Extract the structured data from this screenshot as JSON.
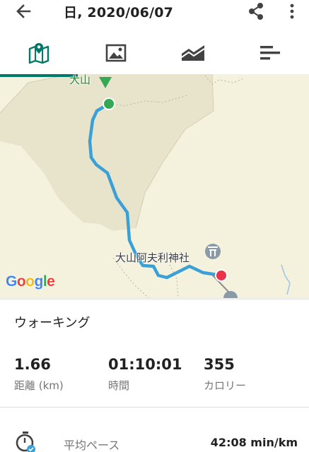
{
  "header": {
    "title": "日, 2020/06/07",
    "back_icon": "arrow-left-icon",
    "share_icon": "share-icon",
    "more_icon": "more-vertical-icon"
  },
  "tabs": [
    {
      "name": "map",
      "icon": "map-icon",
      "selected": true
    },
    {
      "name": "photos",
      "icon": "image-icon",
      "selected": false
    },
    {
      "name": "elevation",
      "icon": "area-chart-icon",
      "selected": false
    },
    {
      "name": "details",
      "icon": "bar-list-icon",
      "selected": false
    }
  ],
  "map": {
    "peak_label": "大山",
    "shrine_label": "大山阿夫利神社",
    "attribution": {
      "g1": "G",
      "o1": "o",
      "o2": "o",
      "g2": "g",
      "l": "l",
      "e": "e"
    },
    "colors": {
      "route": "#3aa0d6",
      "start": "#34a853",
      "end": "#e8334a",
      "accent": "#00796b"
    }
  },
  "activity": {
    "type": "ウォーキング"
  },
  "stats": [
    {
      "value": "1.66",
      "label": "距離 (km)"
    },
    {
      "value": "01:10:01",
      "label": "時間"
    },
    {
      "value": "355",
      "label": "カロリー"
    }
  ],
  "pace": {
    "label": "平均ペース",
    "value": "42:08 min/km",
    "icon": "stopwatch-icon"
  }
}
